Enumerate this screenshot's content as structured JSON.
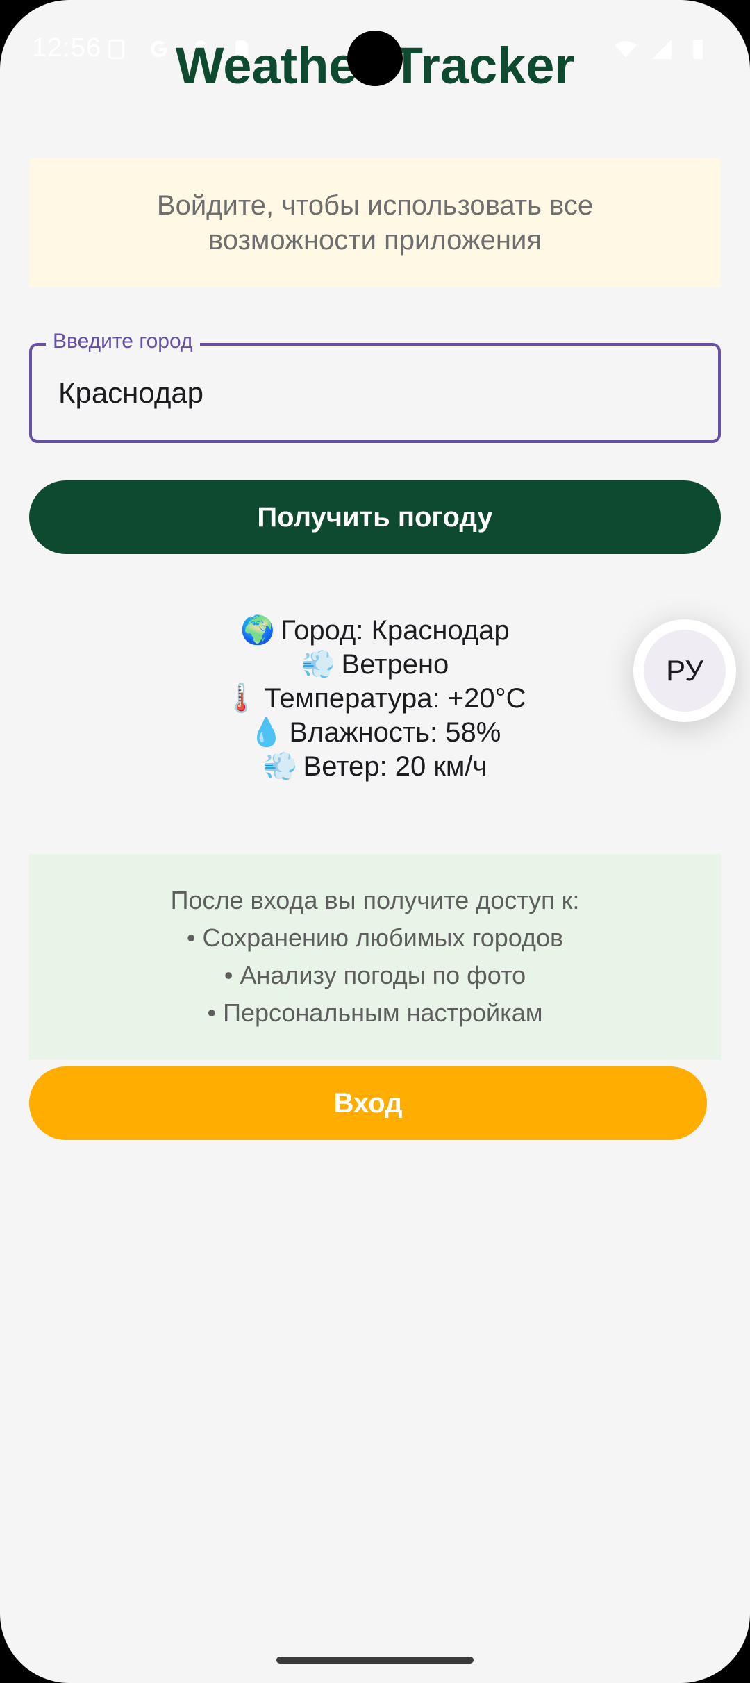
{
  "status_bar": {
    "time": "12:56",
    "left_icons": [
      "screenshot-icon",
      "google-icon",
      "android-icon",
      "sim-icon"
    ],
    "right_icons": [
      "wifi-icon",
      "signal-icon",
      "battery-icon"
    ]
  },
  "app": {
    "title": "Weather Tracker"
  },
  "login_hint": {
    "line1": "Войдите, чтобы использовать все",
    "line2": "возможности приложения"
  },
  "city_input": {
    "label": "Введите город",
    "value": "Краснодар"
  },
  "get_weather_button": {
    "label": "Получить погоду"
  },
  "weather": {
    "lines": [
      {
        "icon": "🌍",
        "text": "Город: Краснодар"
      },
      {
        "icon": "💨",
        "text": "Ветрено"
      },
      {
        "icon": "🌡️",
        "text": "Температура: +20°C"
      },
      {
        "icon": "💧",
        "text": "Влажность: 58%"
      },
      {
        "icon": "💨",
        "text": "Ветер: 20 км/ч"
      }
    ]
  },
  "language_button": {
    "label": "РУ"
  },
  "benefits": {
    "heading": "После входа вы получите доступ к:",
    "items": [
      "• Сохранению любимых городов",
      "• Анализу погоды по фото",
      "• Персональным настройкам"
    ]
  },
  "login_button": {
    "label": "Вход"
  },
  "colors": {
    "primary_green": "#0e4a30",
    "accent_purple": "#6750a4",
    "login_orange": "#ffad00",
    "hint_background": "#fff8e5",
    "benefits_background": "#e8f4e8"
  }
}
